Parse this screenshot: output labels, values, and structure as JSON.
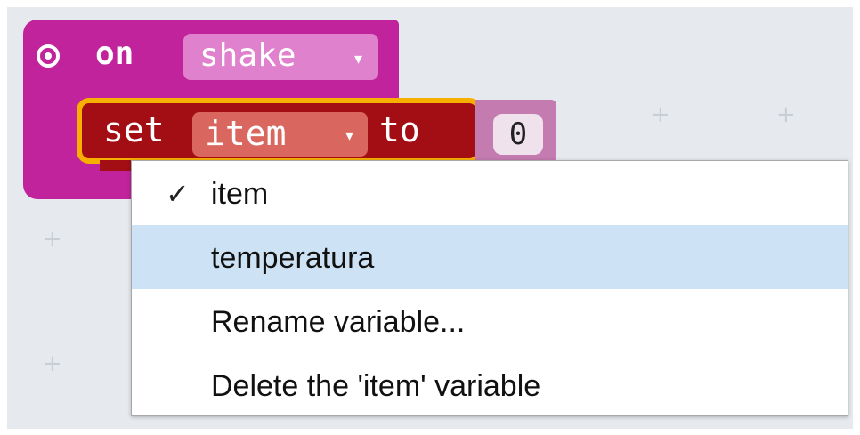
{
  "hat_block": {
    "event_label": "on",
    "event_value": "shake",
    "icon": "target-icon",
    "color": "#c0239b"
  },
  "set_block": {
    "set_label": "set",
    "variable": "item",
    "to_label": "to",
    "value": "0",
    "color": "#a30e14",
    "highlight_color": "#f7b000"
  },
  "dropdown_menu": {
    "items": [
      {
        "label": "item",
        "checked": true
      },
      {
        "label": "temperatura",
        "highlighted": true
      },
      {
        "label": "Rename variable..."
      },
      {
        "label": "Delete the 'item' variable"
      }
    ],
    "check_glyph": "✓",
    "highlight_color": "#cde3f5"
  },
  "caret_glyph": "▾"
}
